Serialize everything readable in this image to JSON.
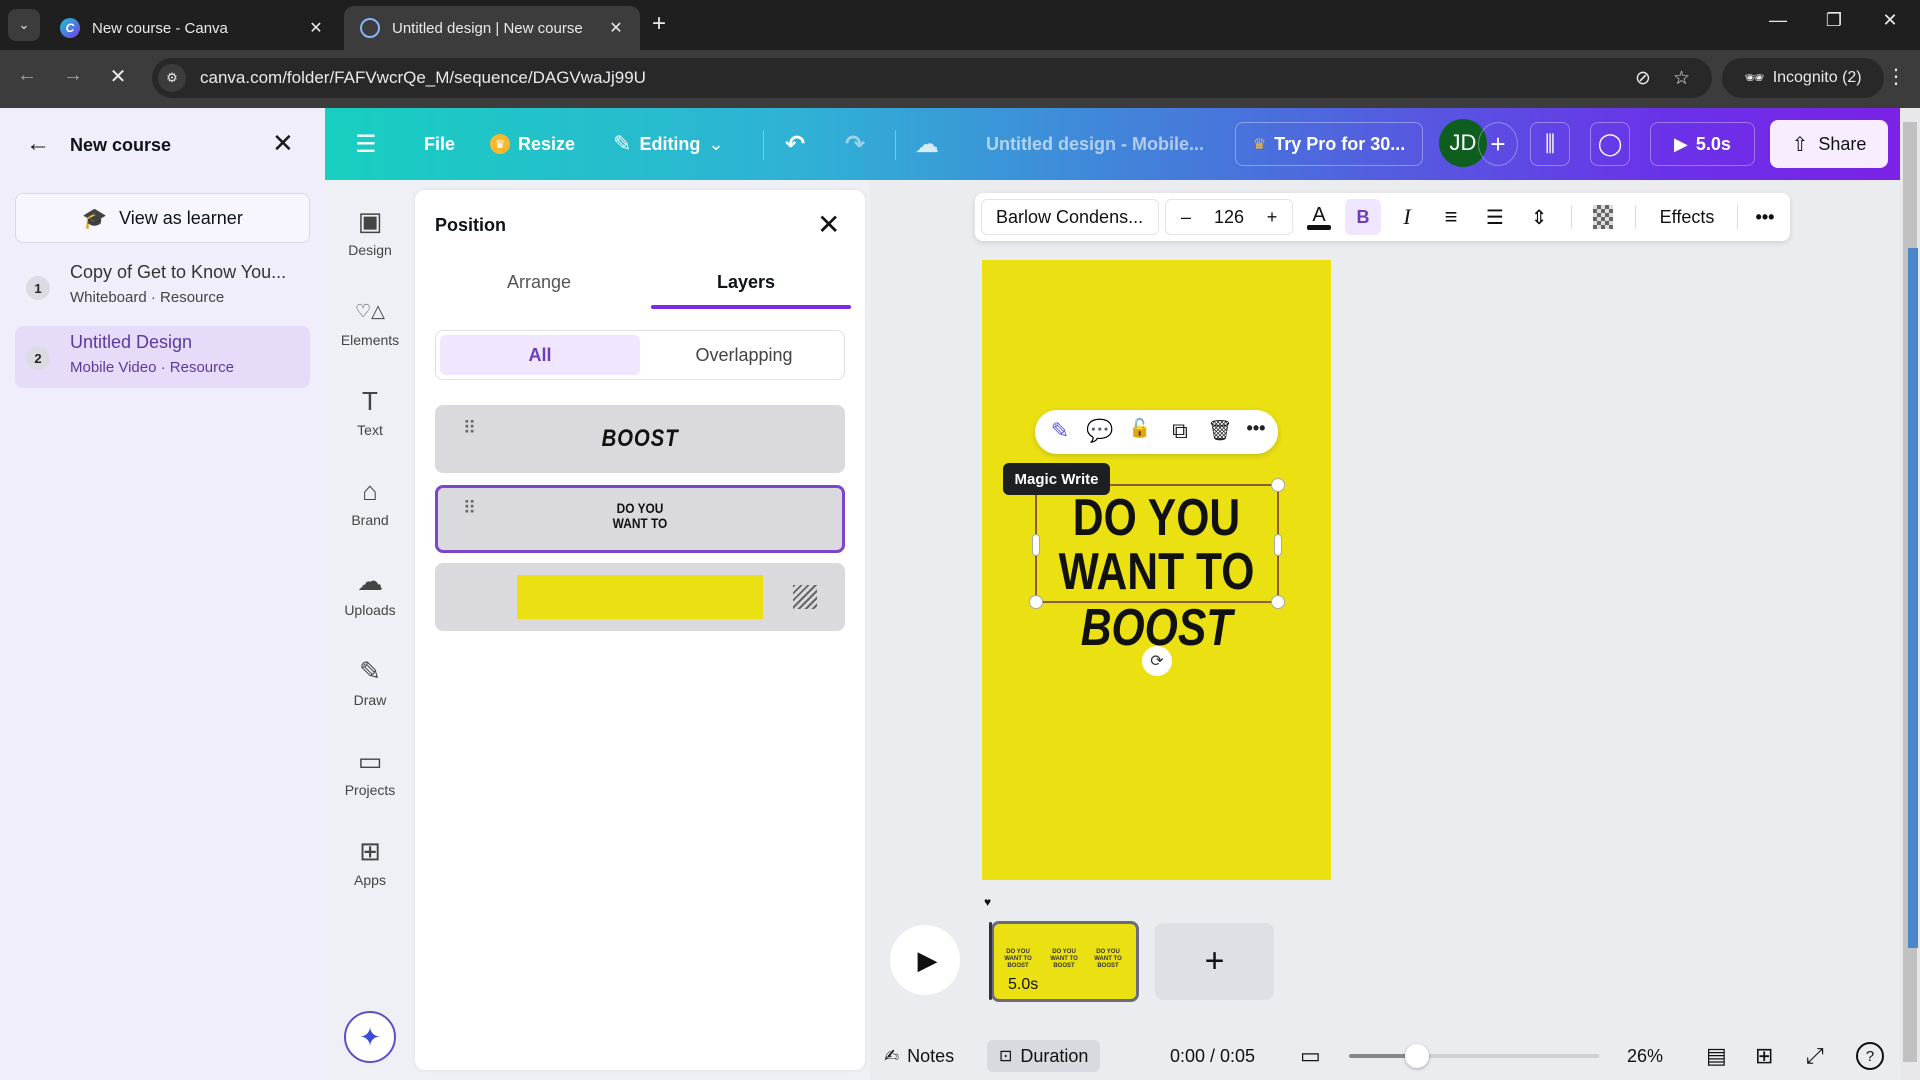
{
  "browser": {
    "tabs": [
      {
        "title": "New course - Canva",
        "active": false
      },
      {
        "title": "Untitled design | New course",
        "active": true
      }
    ],
    "new_tab_icon": "+",
    "url": "canva.com/folder/FAFVwcrQe_M/sequence/DAGVwaJj99U",
    "incognito_label": "Incognito (2)",
    "window_controls": {
      "minimize": "—",
      "restore": "❐",
      "close": "✕"
    }
  },
  "course_panel": {
    "title": "New course",
    "view_as_learner": "View as learner",
    "items": [
      {
        "num": "1",
        "title": "Copy of Get to Know You...",
        "subtitle": "Whiteboard · Resource",
        "active": false
      },
      {
        "num": "2",
        "title": "Untitled Design",
        "subtitle": "Mobile Video · Resource",
        "active": true
      }
    ]
  },
  "header": {
    "file": "File",
    "resize": "Resize",
    "editing": "Editing",
    "design_title": "Untitled design - Mobile...",
    "try_pro": "Try Pro for 30...",
    "avatar_initials": "JD",
    "play_duration": "5.0s",
    "share": "Share"
  },
  "rail": {
    "items": [
      {
        "label": "Design",
        "icon": "▣"
      },
      {
        "label": "Elements",
        "icon": "♡△"
      },
      {
        "label": "Text",
        "icon": "T"
      },
      {
        "label": "Brand",
        "icon": "⌂"
      },
      {
        "label": "Uploads",
        "icon": "☁"
      },
      {
        "label": "Draw",
        "icon": "✎"
      },
      {
        "label": "Projects",
        "icon": "▭"
      },
      {
        "label": "Apps",
        "icon": "⊞"
      }
    ]
  },
  "position_panel": {
    "title": "Position",
    "tabs": [
      "Arrange",
      "Layers"
    ],
    "active_tab": "Layers",
    "filters": [
      "All",
      "Overlapping"
    ],
    "active_filter": "All",
    "layers": [
      {
        "type": "text",
        "text": "BOOST",
        "selected": false
      },
      {
        "type": "text",
        "text_line1": "DO YOU",
        "text_line2": "WANT TO",
        "selected": true
      },
      {
        "type": "background",
        "color": "#ebe012",
        "selected": false
      }
    ]
  },
  "text_toolbar": {
    "font": "Barlow Condens...",
    "size": "126",
    "minus": "–",
    "plus": "+",
    "bold": "B",
    "italic": "I",
    "effects": "Effects",
    "more": "•••"
  },
  "canvas": {
    "background": "#ebe012",
    "line1": "DO YOU",
    "line2": "WANT TO",
    "line3": "BOOST",
    "tooltip": "Magic Write"
  },
  "timeline": {
    "clip_duration": "5.0s",
    "clip_thumb_text": [
      "DO YOU",
      "WANT TO",
      "BOOST"
    ],
    "add_page": "+"
  },
  "bottom_bar": {
    "notes": "Notes",
    "duration": "Duration",
    "time": "0:00 / 0:05",
    "zoom_percent": "26%",
    "zoom_fraction": 0.27
  },
  "colors": {
    "accent": "#7d2ae8",
    "canvas_yellow": "#ebe012"
  }
}
